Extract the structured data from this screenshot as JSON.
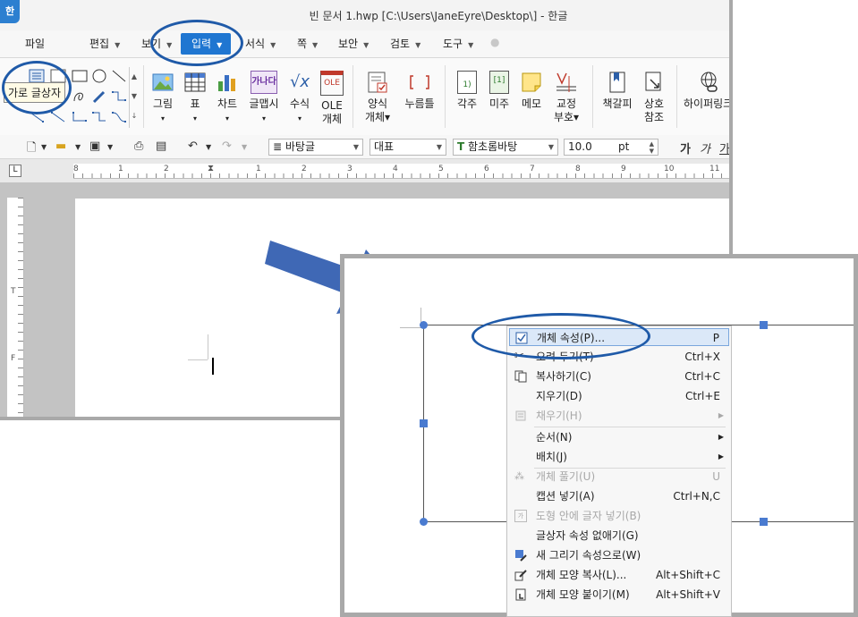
{
  "window": {
    "app_logo": "한",
    "title": "빈 문서 1.hwp [C:\\Users\\JaneEyre\\Desktop\\] - 한글"
  },
  "menubar": {
    "items": [
      "파일",
      "편집",
      "보기",
      "입력",
      "서식",
      "쪽",
      "보안",
      "검토",
      "도구"
    ]
  },
  "ribbon": {
    "tooltip": "가로 글상자",
    "buttons": [
      {
        "label": "그림",
        "sub": "▾",
        "icon": "picture-icon"
      },
      {
        "label": "표",
        "sub": "▾",
        "icon": "table-icon"
      },
      {
        "label": "차트",
        "sub": "▾",
        "icon": "chart-icon"
      },
      {
        "label": "글맵시",
        "sub": "▾",
        "icon": "wordart-icon"
      },
      {
        "label": "수식",
        "sub": "▾",
        "icon": "formula-icon"
      },
      {
        "label": "OLE",
        "sub": "개체",
        "icon": "ole-icon"
      },
      {
        "label": "양식",
        "sub": "개체▾",
        "icon": "form-icon"
      },
      {
        "label": "누름틀",
        "sub": "",
        "icon": "field-icon"
      },
      {
        "label": "각주",
        "sub": "",
        "icon": "footnote-icon"
      },
      {
        "label": "미주",
        "sub": "",
        "icon": "endnote-icon"
      },
      {
        "label": "메모",
        "sub": "",
        "icon": "memo-icon"
      },
      {
        "label": "교정",
        "sub": "부호▾",
        "icon": "proofmark-icon"
      },
      {
        "label": "책갈피",
        "sub": "",
        "icon": "bookmark-icon"
      },
      {
        "label": "상호",
        "sub": "참조",
        "icon": "crossref-icon"
      },
      {
        "label": "하이퍼링크",
        "sub": "",
        "icon": "hyperlink-icon"
      }
    ],
    "ole_icon_text": "OLE",
    "wordart_icon_text": "가나다",
    "formula_icon_text": "√x",
    "endnote_icon_text": "[1]",
    "footnote_icon_text": "1)"
  },
  "formatbar": {
    "style": "바탕글",
    "language": "대표",
    "font_icon": "T",
    "font": "함초롬바탕",
    "size": "10.0",
    "unit": "pt",
    "bold_glyph": "가",
    "italic_glyph": "가",
    "underline_glyph": "가"
  },
  "ruler": {
    "numbers": [
      "8",
      "1",
      "2",
      "1",
      "2",
      "3",
      "4",
      "5",
      "6",
      "7",
      "8",
      "9",
      "10",
      "11"
    ]
  },
  "context_menu": {
    "items": [
      {
        "label": "개체 속성(P)...",
        "shortcut": "P",
        "disabled": false,
        "icon": "object-properties-icon"
      },
      {
        "label": "오려 두기(T)",
        "shortcut": "Ctrl+X",
        "disabled": false,
        "icon": "cut-icon"
      },
      {
        "label": "복사하기(C)",
        "shortcut": "Ctrl+C",
        "disabled": false,
        "icon": "copy-icon"
      },
      {
        "label": "지우기(D)",
        "shortcut": "Ctrl+E",
        "disabled": false,
        "icon": ""
      },
      {
        "label": "채우기(H)",
        "shortcut": "",
        "disabled": true,
        "icon": "fill-icon",
        "submenu": true
      },
      {
        "label": "순서(N)",
        "shortcut": "",
        "disabled": false,
        "icon": "",
        "submenu": true
      },
      {
        "label": "배치(J)",
        "shortcut": "",
        "disabled": false,
        "icon": "",
        "submenu": true
      },
      {
        "label": "개체 풀기(U)",
        "shortcut": "U",
        "disabled": true,
        "icon": "ungroup-icon"
      },
      {
        "label": "캡션 넣기(A)",
        "shortcut": "Ctrl+N,C",
        "disabled": false,
        "icon": ""
      },
      {
        "label": "도형 안에 글자 넣기(B)",
        "shortcut": "",
        "disabled": true,
        "icon": "text-in-shape-icon"
      },
      {
        "label": "글상자 속성 없애기(G)",
        "shortcut": "",
        "disabled": false,
        "icon": ""
      },
      {
        "label": "새 그리기 속성으로(W)",
        "shortcut": "",
        "disabled": false,
        "icon": "new-draw-props-icon"
      },
      {
        "label": "개체 모양 복사(L)...",
        "shortcut": "Alt+Shift+C",
        "disabled": false,
        "icon": "copy-shape-icon"
      },
      {
        "label": "개체 모양 붙이기(M)",
        "shortcut": "Alt+Shift+V",
        "disabled": false,
        "icon": "paste-shape-icon"
      }
    ],
    "icon_glyphs": {
      "ole_small": "가"
    }
  },
  "colors": {
    "accent": "#1f76d1",
    "annotation": "#1f5aa8",
    "arrow": "#3f68b5",
    "handle": "#4a7bd0"
  }
}
